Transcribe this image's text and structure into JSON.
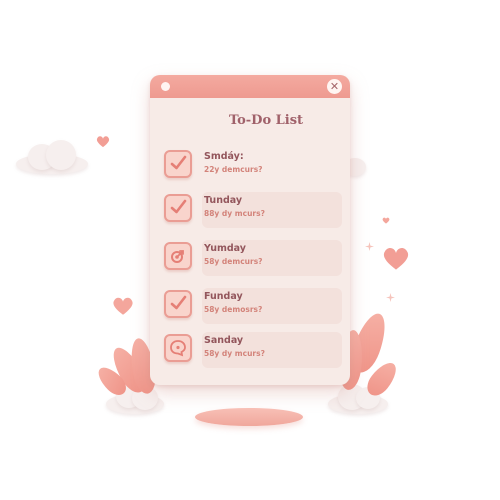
{
  "window": {
    "title": "To-Do List",
    "close_glyph": "✕"
  },
  "tasks": [
    {
      "day": "Smdáy:",
      "sub": "22y demcurs?",
      "icon": "checkmark-icon",
      "checked": true
    },
    {
      "day": "Tunday",
      "sub": "88y dy mcurs?",
      "icon": "checkmark-icon",
      "checked": true
    },
    {
      "day": "Yumday",
      "sub": "58y demcurs?",
      "icon": "target-arrow-icon",
      "checked": false
    },
    {
      "day": "Funday",
      "sub": "58y demosrs?",
      "icon": "checkmark-icon",
      "checked": true
    },
    {
      "day": "Sanday",
      "sub": "58y dy mcurs?",
      "icon": "chat-bubble-icon",
      "checked": false
    }
  ],
  "colors": {
    "accent": "#ee9a90",
    "panel": "#f7ebe7",
    "title_text": "#a0616a",
    "subtext": "#d3837a"
  }
}
